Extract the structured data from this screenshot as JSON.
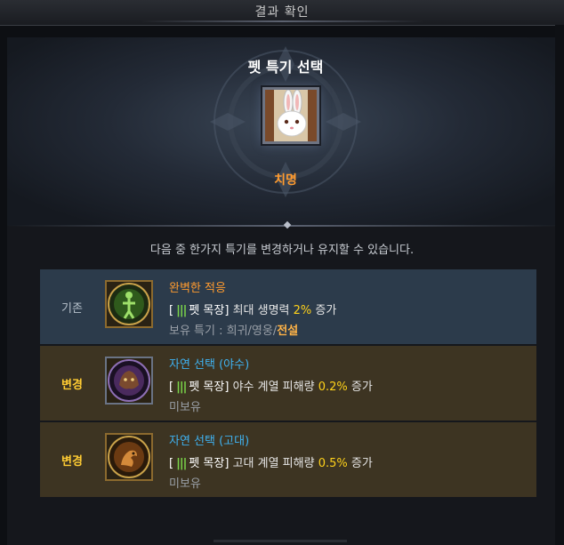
{
  "window": {
    "title": "결과 확인"
  },
  "hero": {
    "title": "펫 특기 선택",
    "pet_name": "치명"
  },
  "description": "다음 중 한가지 특기를 변경하거나 유지할 수 있습니다.",
  "options": [
    {
      "label": "기존",
      "icon": "green-figure-skill-icon",
      "name": "완벽한 적응",
      "bracket_open": "[",
      "source": "펫 목장",
      "bracket_close": "]",
      "effect_text": "최대 생명력",
      "value": "2%",
      "suffix": "증가",
      "owned_label": "보유 특기 : ",
      "owned_tiers": "희귀/영웅/",
      "owned_highlight": "전설"
    },
    {
      "label": "변경",
      "icon": "wild-beast-skill-icon",
      "name": "자연 선택 (야수)",
      "bracket_open": "[",
      "source": "펫 목장",
      "bracket_close": "]",
      "effect_text": "야수 계열 피해량",
      "value": "0.2%",
      "suffix": "증가",
      "owned_label": "미보유"
    },
    {
      "label": "변경",
      "icon": "ancient-dragon-skill-icon",
      "name": "자연 선택 (고대)",
      "bracket_open": "[",
      "source": "펫 목장",
      "bracket_close": "]",
      "effect_text": "고대 계열 피해량",
      "value": "0.5%",
      "suffix": "증가",
      "owned_label": "미보유"
    }
  ],
  "colors": {
    "accent_orange": "#ff9b2f",
    "skill_blue": "#3fb2f1",
    "value_yellow": "#ffd21a",
    "change_label": "#ffcc33"
  }
}
